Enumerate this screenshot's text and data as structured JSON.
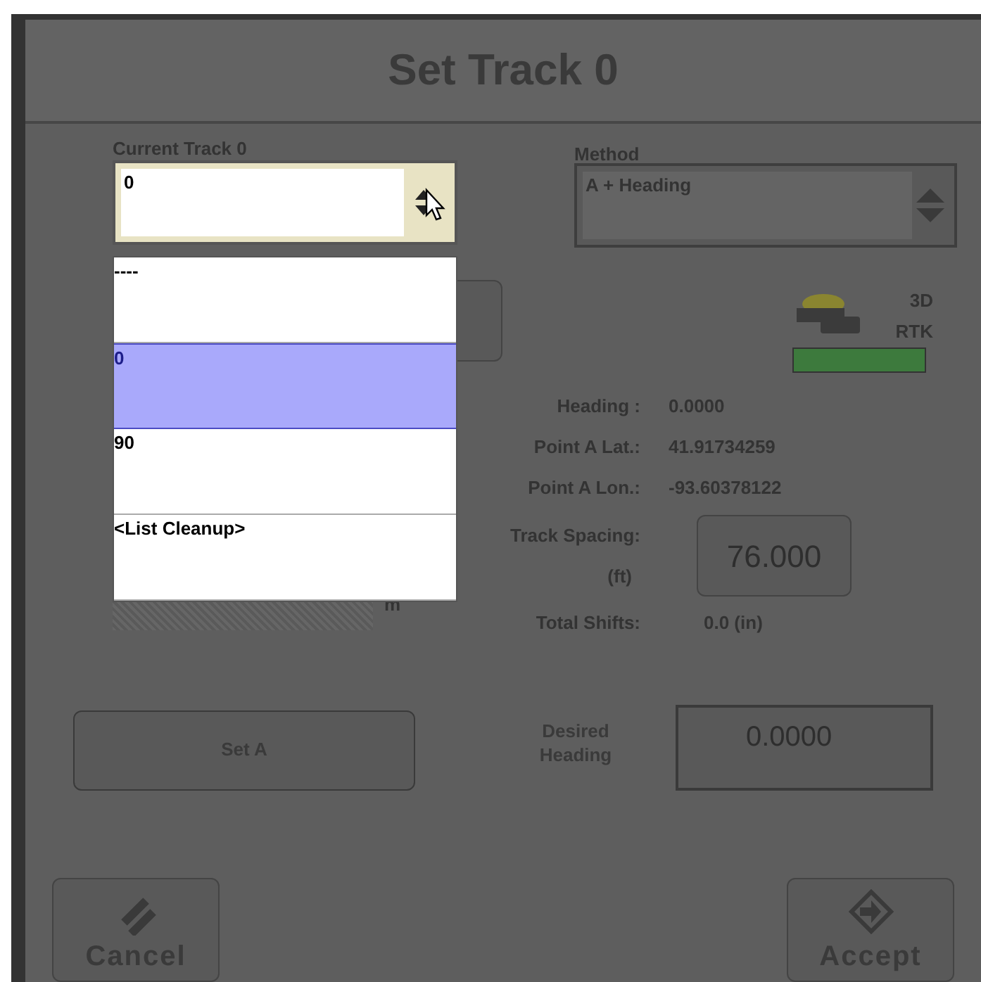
{
  "window": {
    "title": "Set Track 0"
  },
  "current_track": {
    "label": "Current Track 0",
    "value": "0",
    "unit": "m",
    "list": [
      {
        "label": "----",
        "selected": false
      },
      {
        "label": "0",
        "selected": true
      },
      {
        "label": "90",
        "selected": false
      },
      {
        "label": "<List Cleanup>",
        "selected": false
      }
    ]
  },
  "method": {
    "label": "Method",
    "value": "A + Heading"
  },
  "gps": {
    "lines": [
      "3D",
      "RTK"
    ]
  },
  "info": [
    {
      "label": "Heading :",
      "value": "0.0000"
    },
    {
      "label": "Point A Lat.:",
      "value": "41.91734259"
    },
    {
      "label": "Point A Lon.:",
      "value": "-93.60378122"
    }
  ],
  "track_spacing": {
    "label": "Track Spacing:",
    "unit": "(ft)",
    "value": "76.000"
  },
  "total_shifts": {
    "label": "Total Shifts:",
    "value": "0.0 (in)"
  },
  "set_a": "Set A",
  "desired_heading": {
    "label": "Desired Heading",
    "value": "0.0000"
  },
  "buttons": [
    {
      "kind": "cancel",
      "label": "Cancel"
    },
    {
      "kind": "accept",
      "label": "Accept"
    }
  ]
}
